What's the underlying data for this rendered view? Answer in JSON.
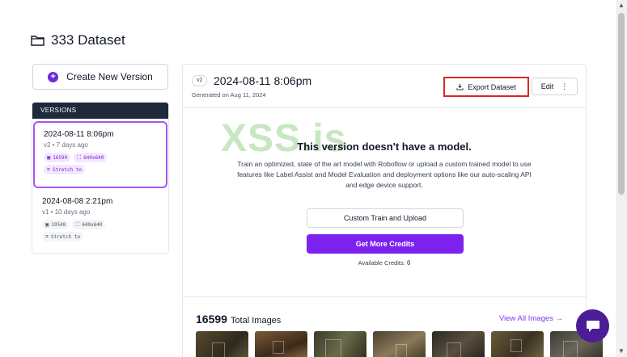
{
  "page": {
    "title": "333 Dataset"
  },
  "sidebar": {
    "create_label": "Create New Version",
    "versions_heading": "VERSIONS",
    "versions": [
      {
        "date": "2024-08-11 8:06pm",
        "meta": "v2 • 7 days ago",
        "images": "16599",
        "size": "640x640",
        "transform": "Stretch to",
        "selected": true
      },
      {
        "date": "2024-08-08 2:21pm",
        "meta": "v1 • 10 days ago",
        "images": "19548",
        "size": "640x640",
        "transform": "Stretch to",
        "selected": false
      }
    ]
  },
  "main": {
    "version_badge": "v2",
    "title": "2024-08-11 8:06pm",
    "subtitle": "Generated on Aug 11, 2024",
    "export_label": "Export Dataset",
    "edit_label": "Edit",
    "model_title": "This version doesn't have a model.",
    "model_desc": "Train an optimized, state of the art model with Roboflow or upload a custom trained model to use features like Label Assist and Model Evaluation and deployment options like our auto-scaling API and edge device support.",
    "custom_train_label": "Custom Train and Upload",
    "get_credits_label": "Get More Credits",
    "credits_label": "Available Credits:",
    "credits_value": "0",
    "images_count": "16599",
    "images_label": "Total Images",
    "view_all_label": "View All Images →",
    "watermark": "XSS.is"
  },
  "colors": {
    "accent": "#7c22ef",
    "highlight": "#dc2626",
    "nav_dark": "#1e293b"
  },
  "icons": [
    "folder-icon",
    "plus-icon",
    "image-icon",
    "resize-icon",
    "crop-icon",
    "download-icon",
    "more-vertical-icon",
    "chat-icon"
  ]
}
